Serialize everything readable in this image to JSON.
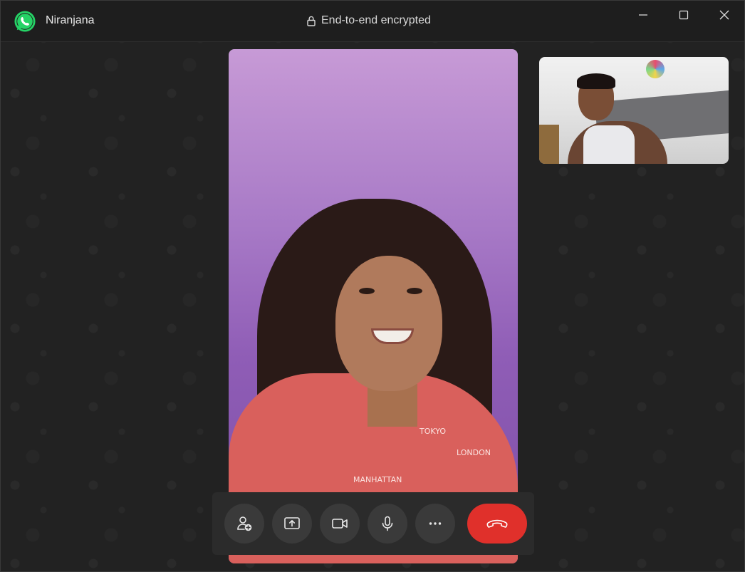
{
  "titlebar": {
    "caller_name": "Niranjana",
    "encryption_label": "End-to-end encrypted"
  },
  "icons": {
    "app": "whatsapp-icon",
    "lock": "lock-icon",
    "minimize": "minimize-icon",
    "maximize": "maximize-icon",
    "close": "close-icon",
    "add_participant": "add-person-icon",
    "share_screen": "share-screen-icon",
    "camera": "video-camera-icon",
    "microphone": "microphone-icon",
    "more": "more-options-icon",
    "end_call": "end-call-icon"
  },
  "colors": {
    "brand": "#25D366",
    "end_call": "#E0302B",
    "background": "#222222",
    "control_bar": "#2B2B2B"
  },
  "video": {
    "remote_shirt_text": [
      "TOKYO",
      "LONDON",
      "MANHATTAN"
    ]
  }
}
